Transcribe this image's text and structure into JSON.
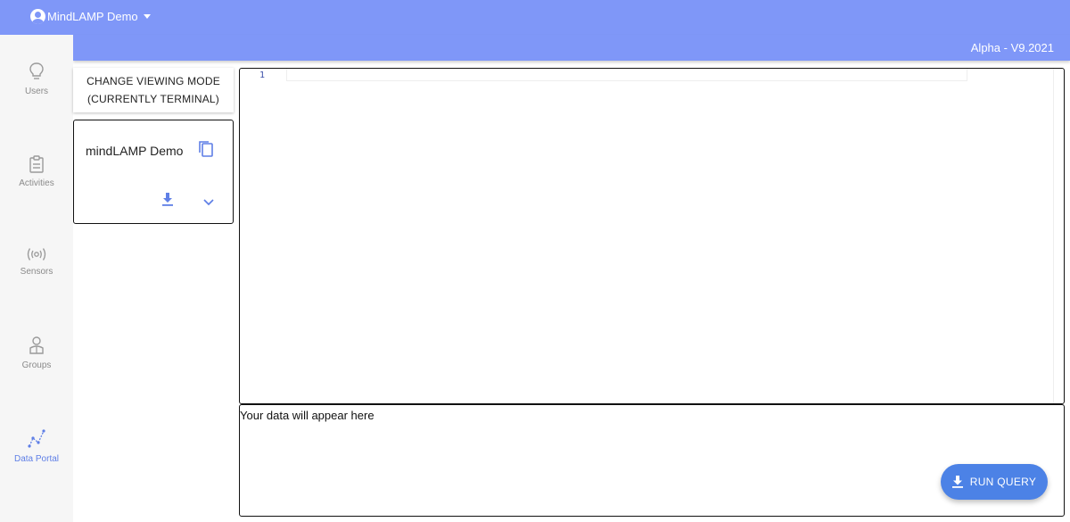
{
  "header": {
    "account_name": "MindLAMP Demo",
    "version": "Alpha - V9.2021"
  },
  "sidebar": {
    "items": [
      {
        "label": "Users",
        "icon": "lightbulb-icon"
      },
      {
        "label": "Activities",
        "icon": "clipboard-icon"
      },
      {
        "label": "Sensors",
        "icon": "sensor-icon"
      },
      {
        "label": "Groups",
        "icon": "groups-icon"
      },
      {
        "label": "Data Portal",
        "icon": "data-portal-icon",
        "active": true
      }
    ]
  },
  "viewing_mode": {
    "line1": "CHANGE VIEWING MODE",
    "line2": "(CURRENTLY TERMINAL)"
  },
  "study_card": {
    "title": "mindLAMP Demo"
  },
  "editor": {
    "line_number": "1"
  },
  "output": {
    "placeholder": "Your data will appear here"
  },
  "run_query": {
    "label": "RUN QUERY"
  },
  "colors": {
    "accent": "#7f97f8",
    "button": "#4c82e6",
    "active_nav": "#5f7fe6"
  }
}
